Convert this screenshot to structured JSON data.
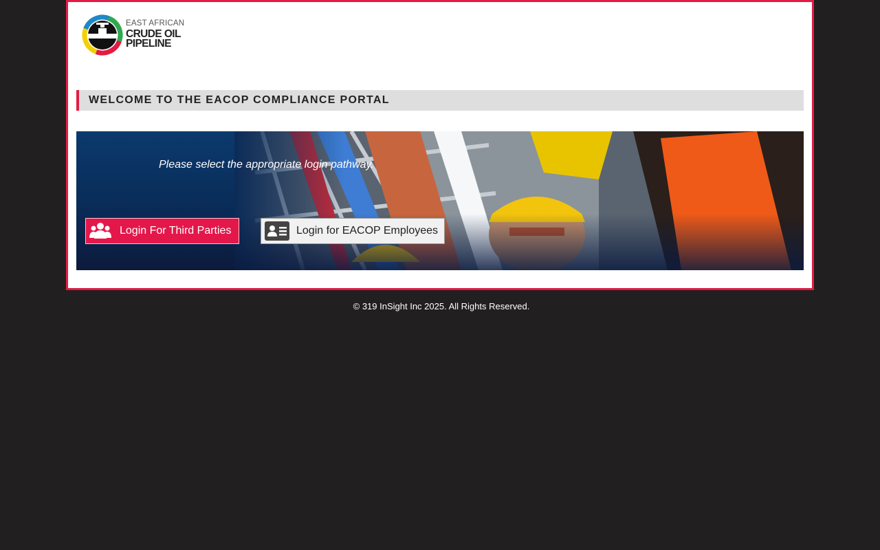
{
  "colors": {
    "accent": "#e31b45",
    "background": "#221f20",
    "employee_button": "#f1f1f1"
  },
  "logo": {
    "line1": "EAST AFRICAN",
    "line2": "CRUDE OIL",
    "line3": "PIPELINE"
  },
  "welcome": {
    "title": "WELCOME TO THE EACOP COMPLIANCE PORTAL"
  },
  "banner": {
    "prompt": "Please select the appropriate login pathway.",
    "third_party_button": {
      "label": "Login For Third Parties",
      "icon": "group-icon"
    },
    "employee_button": {
      "label": "Login for EACOP Employees",
      "icon": "id-card-icon"
    }
  },
  "footer": {
    "copyright": "© 319 InSight Inc 2025. All Rights Reserved."
  }
}
